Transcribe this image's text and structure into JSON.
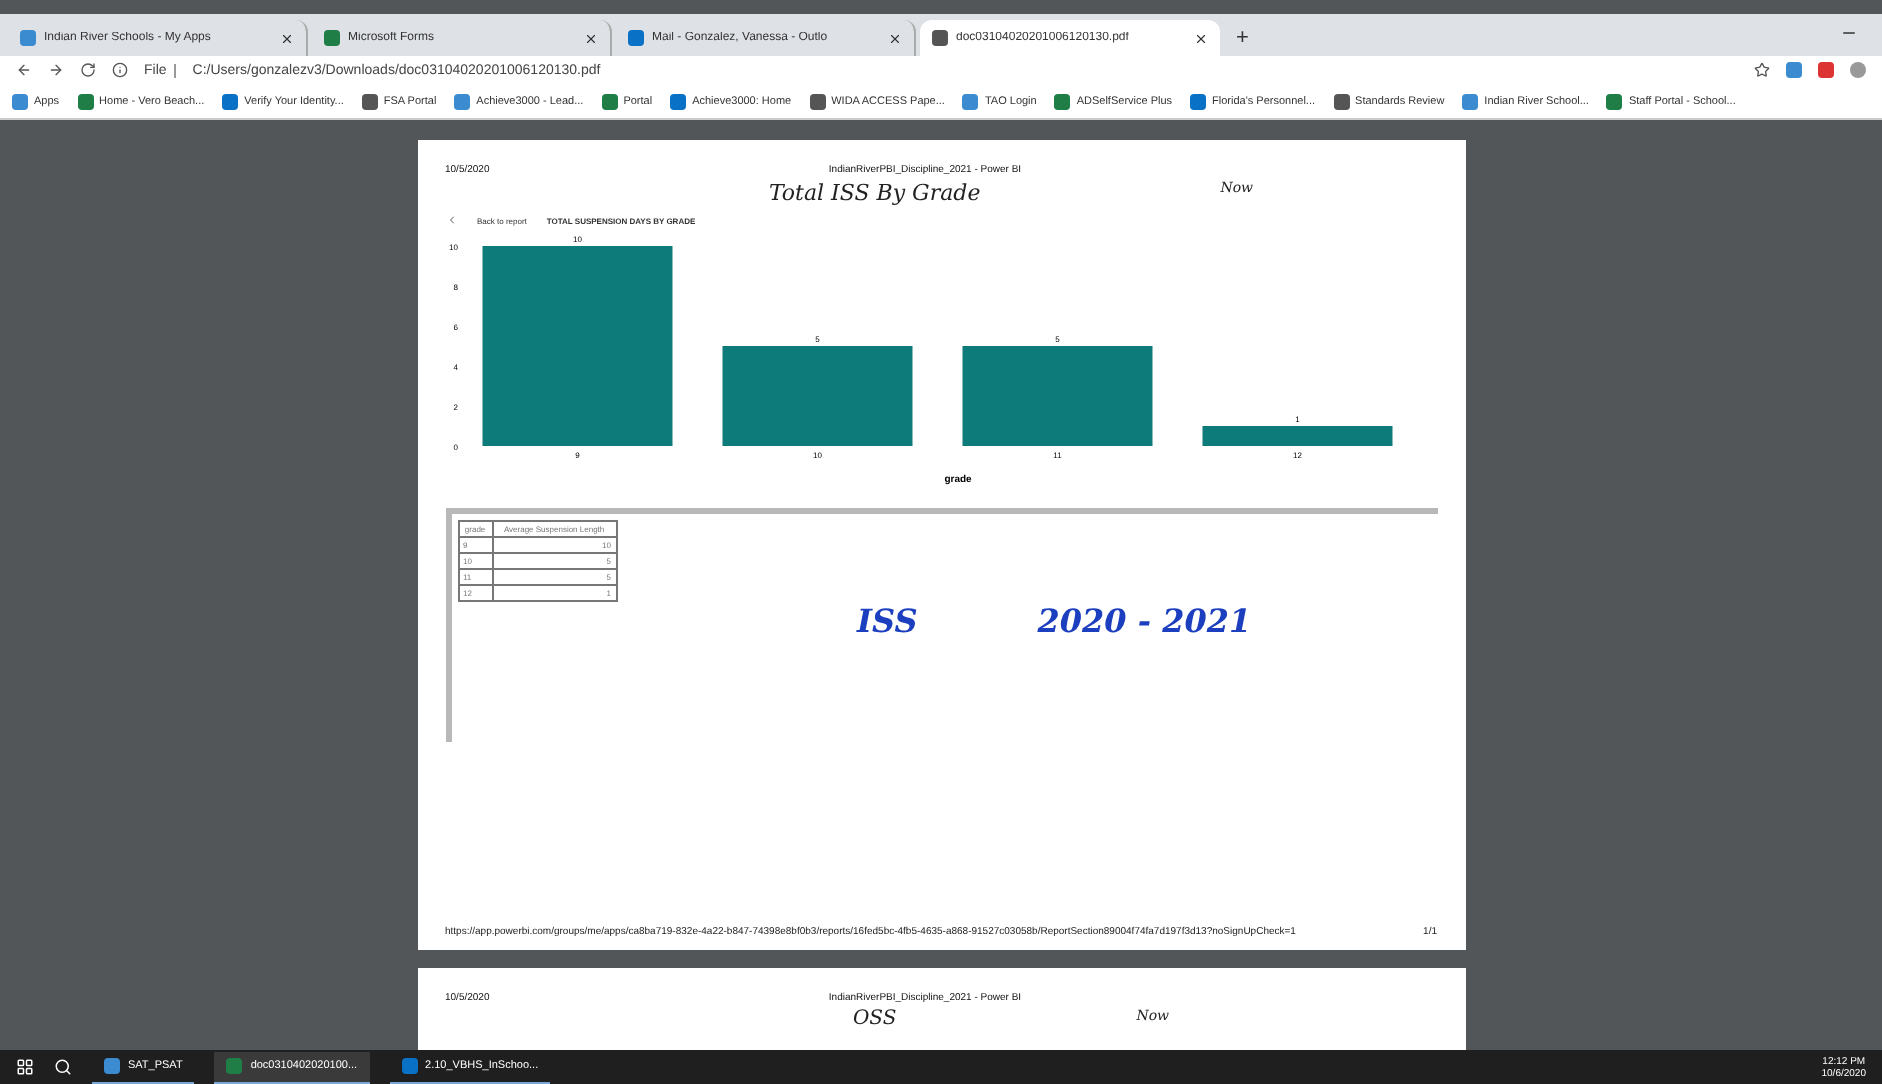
{
  "browser": {
    "tabs": [
      {
        "title": "Indian River Schools - My Apps",
        "selected": false
      },
      {
        "title": "Microsoft Forms",
        "selected": false
      },
      {
        "title": "Mail - Gonzalez, Vanessa - Outlo",
        "selected": false
      },
      {
        "title": "doc03104020201006120130.pdf",
        "selected": true
      }
    ],
    "new_tab": "+",
    "address": {
      "scheme": "File",
      "url": "C:/Users/gonzalezv3/Downloads/doc03104020201006120130.pdf"
    },
    "bookmarks": [
      "Apps",
      "Home - Vero Beach...",
      "Verify Your Identity...",
      "FSA Portal",
      "Achieve3000 - Lead...",
      "Portal",
      "Achieve3000: Home",
      "WIDA ACCESS Pape...",
      "TAO Login",
      "ADSelfService Plus",
      "Florida's Personnel...",
      "Standards Review",
      "Indian River School...",
      "Staff Portal - School..."
    ]
  },
  "pages": [
    {
      "date": "10/5/2020",
      "title": "IndianRiverPBI_Discipline_2021 - Power BI",
      "handwriting": [
        "Total ISS By Grade",
        "Now"
      ],
      "back": "Back to report",
      "visual_title": "TOTAL SUSPENSION DAYS BY GRADE",
      "chart_data": {
        "type": "bar",
        "xlabel": "grade",
        "categories": [
          "9",
          "10",
          "11",
          "12"
        ],
        "values": [
          10,
          5,
          5,
          1
        ],
        "ylim": [
          0,
          10
        ],
        "yticks": [
          0,
          2,
          4,
          6,
          8,
          10
        ],
        "data_labels": true
      },
      "table": {
        "columns": [
          "grade",
          "Average Suspension Length"
        ],
        "rows": [
          [
            "9",
            "10"
          ],
          [
            "10",
            "5"
          ],
          [
            "11",
            "5"
          ],
          [
            "12",
            "1"
          ]
        ]
      },
      "notes": [
        "ISS",
        "2020 - 2021"
      ],
      "footer_url": "https://app.powerbi.com/groups/me/apps/ca8ba719-832e-4a22-b847-74398e8bf0b3/reports/16fed5bc-4fb5-4635-a868-91527c03058b/ReportSection89004f74fa7d197f3d13?noSignUpCheck=1",
      "page_number": "1/1"
    },
    {
      "date": "10/5/2020",
      "title": "IndianRiverPBI_Discipline_2021 - Power BI",
      "handwriting": [
        "OSS",
        "Now"
      ]
    }
  ],
  "taskbar": {
    "apps": [
      "SAT_PSAT",
      "doc0310402020100...",
      "2.10_VBHS_InSchoo..."
    ],
    "time": "12:12 PM",
    "date": "10/6/2020"
  }
}
